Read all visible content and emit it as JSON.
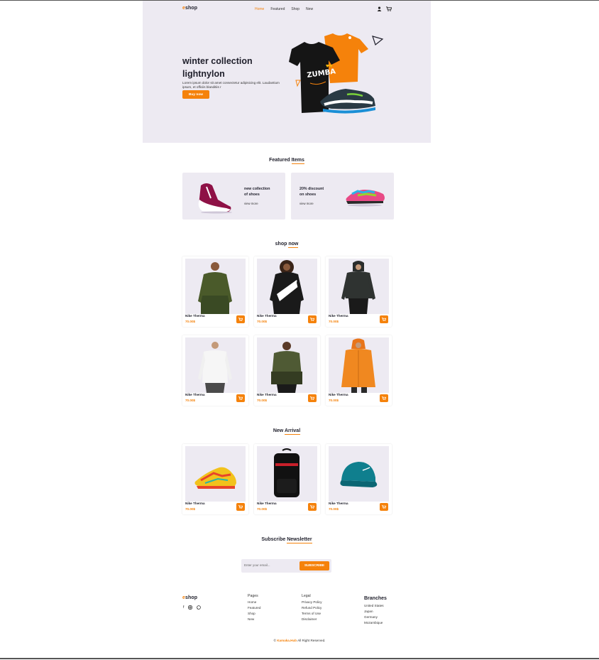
{
  "brand": {
    "logo_prefix": "e",
    "logo_rest": "shop"
  },
  "nav": {
    "items": [
      "Home",
      "Featured",
      "Shop",
      "New"
    ],
    "active": "Home"
  },
  "header_icons": [
    "user-icon",
    "cart-icon"
  ],
  "hero": {
    "title_line1": "winter collection",
    "title_line2": "lightnylon",
    "description": "Lorem ipsum dolor sit amet consectetur adipisicing elit. Laudantium ipsum, et officiis blanditiis r",
    "button": "Buy now"
  },
  "featured": {
    "title": "Featured",
    "title_hl": "Items",
    "cards": [
      {
        "line1": "new collection",
        "line2": "of shoes",
        "link": "view more"
      },
      {
        "line1": "20% discount",
        "line2": "on shoes",
        "link": "view more"
      }
    ]
  },
  "shop": {
    "title": "shop",
    "title_hl": "now",
    "products": [
      {
        "name": "Nike Therma",
        "price": "70.00$"
      },
      {
        "name": "Nike Therma",
        "price": "70.00$"
      },
      {
        "name": "Nike Therma",
        "price": "70.00$"
      },
      {
        "name": "Nike Therma",
        "price": "70.00$"
      },
      {
        "name": "Nike Therma",
        "price": "70.00$"
      },
      {
        "name": "Nike Therma",
        "price": "70.00$"
      }
    ]
  },
  "arrival": {
    "title": "New",
    "title_hl": "Arrival",
    "products": [
      {
        "name": "Nike Therma",
        "price": "70.00$"
      },
      {
        "name": "Nike Therma",
        "price": "70.00$"
      },
      {
        "name": "Nike Therma",
        "price": "70.00$"
      }
    ]
  },
  "newsletter": {
    "title": "Subscribe",
    "title_hl": "Newsletter",
    "placeholder": "Enter your email...",
    "button": "SUBSCRIBE"
  },
  "footer": {
    "pages": {
      "heading": "Pages",
      "items": [
        "Home",
        "Featured",
        "Shop",
        "New"
      ]
    },
    "legal": {
      "heading": "Legal",
      "items": [
        "Privacy Policy",
        "Refund Policy",
        "Terms of Use",
        "Disclaimer"
      ]
    },
    "branches": {
      "heading": "Branches",
      "items": [
        "United States",
        "Japan",
        "Germany",
        "Mozambique"
      ]
    },
    "social_icons": [
      "facebook-icon",
      "instagram-icon",
      "whatsapp-icon"
    ],
    "copyright_prefix": "©",
    "copyright_brand": "Kamaka.Hub",
    "copyright_suffix": "All Right Reserved."
  },
  "colors": {
    "accent": "#f5820b",
    "panel": "#edeaf2",
    "text": "#1f1f2b"
  }
}
